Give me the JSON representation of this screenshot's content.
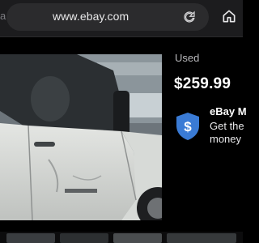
{
  "browser": {
    "url": "www.ebay.com",
    "left_fragment": "a"
  },
  "listing": {
    "condition": "Used",
    "price": "$259.99",
    "guarantee_title": "eBay M",
    "guarantee_line1": "Get the",
    "guarantee_line2": "money"
  },
  "colors": {
    "accent_blue": "#3a7bd5",
    "background": "#000000",
    "toolbar": "#1c1c1e"
  },
  "icons": {
    "reload": "reload-icon",
    "home": "home-icon",
    "guarantee": "shield-dollar-icon"
  }
}
